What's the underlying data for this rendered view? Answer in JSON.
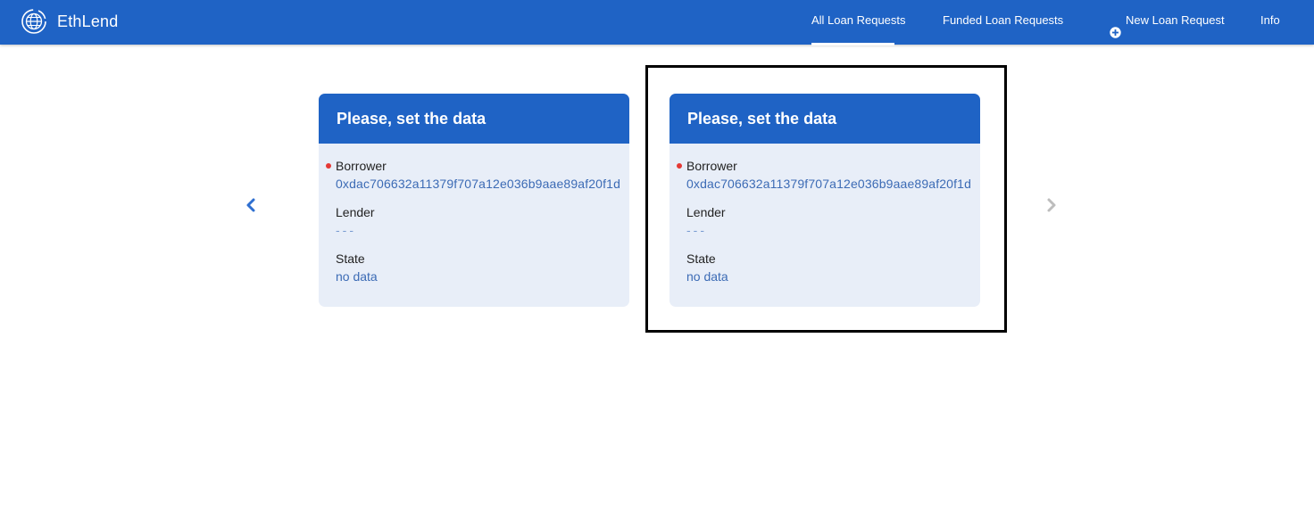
{
  "navbar": {
    "brand": "EthLend",
    "items": [
      {
        "label": "All Loan Requests",
        "active": true
      },
      {
        "label": "Funded Loan Requests",
        "active": false
      },
      {
        "label": "New Loan Request",
        "icon": "plus-circle-icon",
        "active": false
      },
      {
        "label": "Info",
        "active": false
      }
    ]
  },
  "cards": [
    {
      "title": "Please, set the data",
      "borrower_label": "Borrower",
      "borrower_value": "0xdac706632a11379f707a12e036b9aae89af20f1d",
      "lender_label": "Lender",
      "lender_value": "---",
      "state_label": "State",
      "state_value": "no data"
    },
    {
      "title": "Please, set the data",
      "borrower_label": "Borrower",
      "borrower_value": "0xdac706632a11379f707a12e036b9aae89af20f1d",
      "lender_label": "Lender",
      "lender_value": "---",
      "state_label": "State",
      "state_value": "no data"
    }
  ],
  "colors": {
    "primary": "#1f63c5",
    "card_bg": "#e8eef8",
    "value_text": "#3c6bb5",
    "indicator_dot": "#e53935",
    "arrow_active": "#2f6fd0",
    "arrow_disabled": "#bdbdbd"
  }
}
